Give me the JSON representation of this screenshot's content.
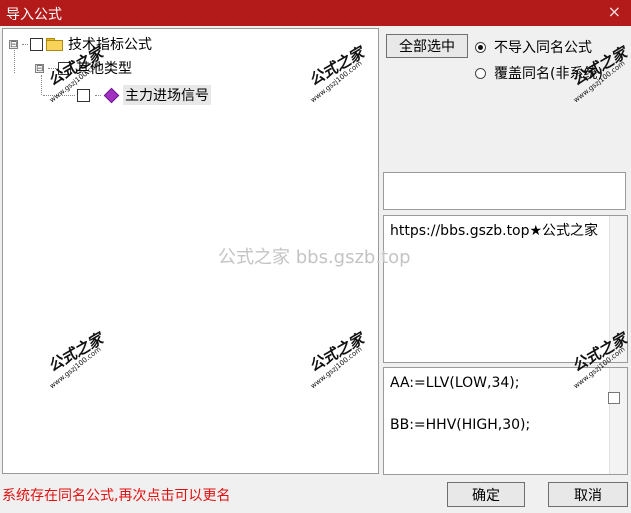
{
  "window": {
    "title": "导入公式",
    "close_icon": "×"
  },
  "tree": {
    "root": {
      "expander": "⊟",
      "label": "技术指标公式"
    },
    "group": {
      "expander": "⊟",
      "label": "其他类型"
    },
    "formula": {
      "label": "主力进场信号"
    }
  },
  "actions": {
    "select_all": "全部选中",
    "radio_no_import": "不导入同名公式",
    "radio_overwrite": "覆盖同名(非系统)",
    "radio_selected": "no_import"
  },
  "info": {
    "text": "https://bbs.gszb.top★公式之家"
  },
  "code": {
    "lines": [
      "AA:=LLV(LOW,34);",
      "BB:=HHV(HIGH,30);"
    ]
  },
  "status": {
    "message": "系统存在同名公式,再次点击可以更名"
  },
  "footer": {
    "ok": "确定",
    "cancel": "取消"
  },
  "watermarks": {
    "stamp_text": "公式之家",
    "stamp_url": "www.gszj100.com",
    "center_text": "公式之家 bbs.gszb.top"
  },
  "colors": {
    "titlebar": "#b31b1b",
    "status_text": "#e01010"
  }
}
